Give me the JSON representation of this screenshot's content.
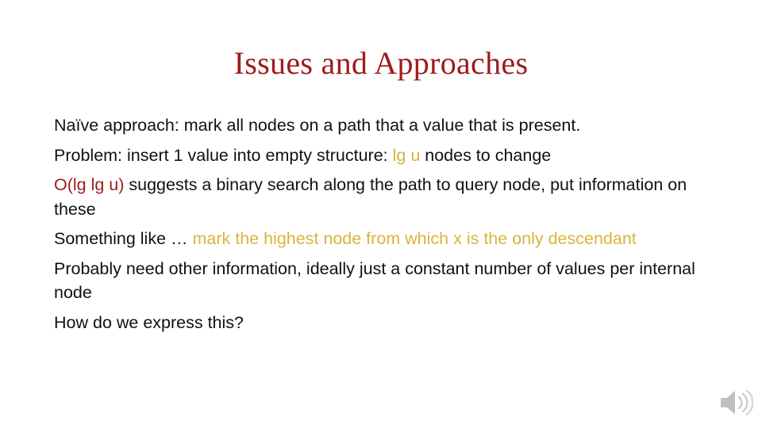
{
  "slide": {
    "title": "Issues and Approaches",
    "title_color": "#9E1B1B",
    "background_color": "#FFFFFF",
    "accent_gold": "#D9B53C",
    "accent_red": "#9E1B1B",
    "body_text_color": "#111111"
  },
  "body": {
    "p1": {
      "text": "Naïve approach: mark all nodes on a path that a value that is present."
    },
    "p2": {
      "lead": "Problem: insert 1 value into empty structure: ",
      "emphasis": "lg u",
      "tail": " nodes to change"
    },
    "p3": {
      "emphasis": "O(lg lg u)",
      "tail": " suggests a binary search along the path to query node, put information on these"
    },
    "p4": {
      "lead": "Something like … ",
      "emphasis": "mark the highest node from which x is the only descendant"
    },
    "p5": {
      "text": "Probably need other information, ideally just a constant number of values per internal node"
    },
    "p6": {
      "text": "How do we express this?"
    }
  },
  "media": {
    "audio_icon_name": "speaker-icon",
    "audio_icon_color": "#BFBFBF"
  }
}
